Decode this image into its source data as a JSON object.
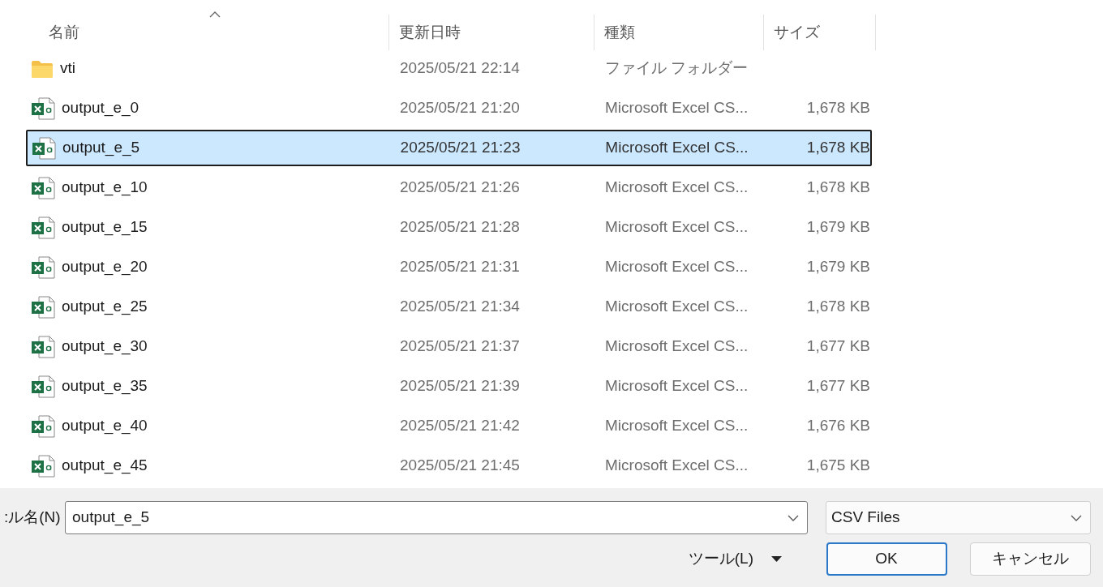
{
  "columns": [
    {
      "label": "名前",
      "sorted": true
    },
    {
      "label": "更新日時",
      "sorted": false
    },
    {
      "label": "種類",
      "sorted": false
    },
    {
      "label": "サイズ",
      "sorted": false
    }
  ],
  "files": [
    {
      "kind": "folder",
      "name": "vti",
      "date": "2025/05/21 22:14",
      "type": "ファイル フォルダー",
      "selected": false
    },
    {
      "kind": "csv",
      "name": "output_e_0",
      "date": "2025/05/21 21:20",
      "type": "Microsoft Excel CS...",
      "size": "1,678 KB",
      "selected": false
    },
    {
      "kind": "csv",
      "name": "output_e_5",
      "date": "2025/05/21 21:23",
      "type": "Microsoft Excel CS...",
      "size": "1,678 KB",
      "selected": true
    },
    {
      "kind": "csv",
      "name": "output_e_10",
      "date": "2025/05/21 21:26",
      "type": "Microsoft Excel CS...",
      "size": "1,678 KB",
      "selected": false
    },
    {
      "kind": "csv",
      "name": "output_e_15",
      "date": "2025/05/21 21:28",
      "type": "Microsoft Excel CS...",
      "size": "1,679 KB",
      "selected": false
    },
    {
      "kind": "csv",
      "name": "output_e_20",
      "date": "2025/05/21 21:31",
      "type": "Microsoft Excel CS...",
      "size": "1,679 KB",
      "selected": false
    },
    {
      "kind": "csv",
      "name": "output_e_25",
      "date": "2025/05/21 21:34",
      "type": "Microsoft Excel CS...",
      "size": "1,678 KB",
      "selected": false
    },
    {
      "kind": "csv",
      "name": "output_e_30",
      "date": "2025/05/21 21:37",
      "type": "Microsoft Excel CS...",
      "size": "1,677 KB",
      "selected": false
    },
    {
      "kind": "csv",
      "name": "output_e_35",
      "date": "2025/05/21 21:39",
      "type": "Microsoft Excel CS...",
      "size": "1,677 KB",
      "selected": false
    },
    {
      "kind": "csv",
      "name": "output_e_40",
      "date": "2025/05/21 21:42",
      "type": "Microsoft Excel CS...",
      "size": "1,676 KB",
      "selected": false
    },
    {
      "kind": "csv",
      "name": "output_e_45",
      "date": "2025/05/21 21:45",
      "type": "Microsoft Excel CS...",
      "size": "1,675 KB",
      "selected": false
    }
  ],
  "filename": {
    "label": "ル名(N):",
    "value": "output_e_5"
  },
  "filter": {
    "value": "CSV Files"
  },
  "tools": {
    "label": "ツール(L)"
  },
  "buttons": [
    {
      "label": "OK",
      "default": true
    },
    {
      "label": "キャンセル",
      "default": false
    }
  ]
}
